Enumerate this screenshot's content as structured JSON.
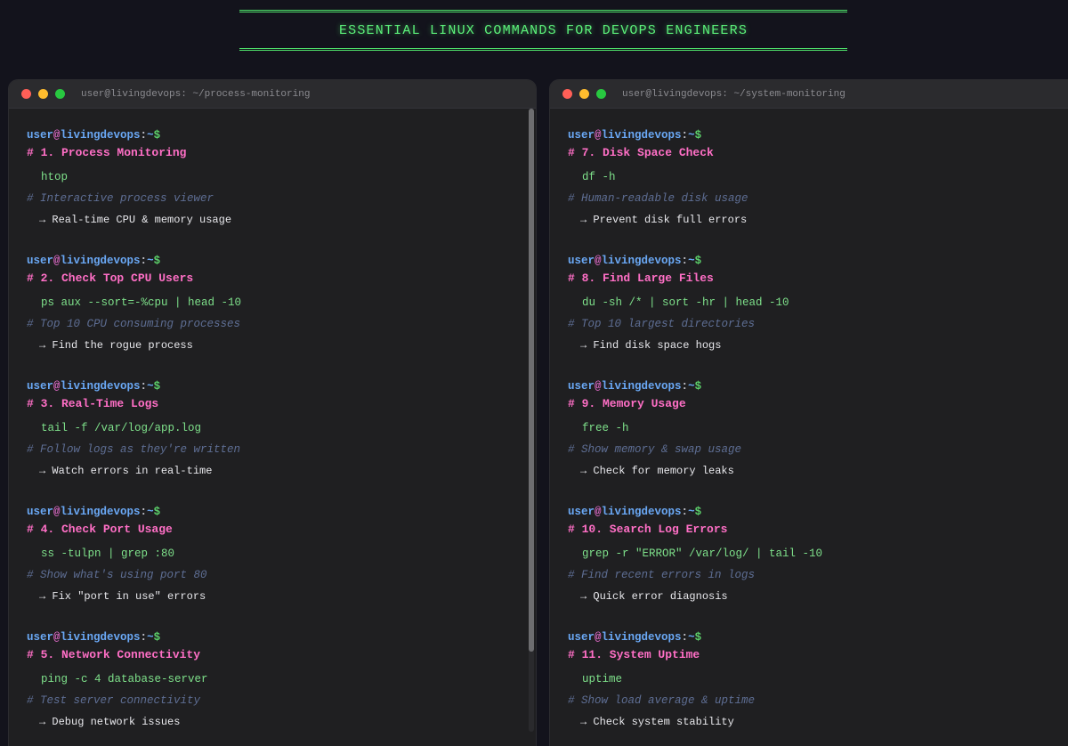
{
  "banner": {
    "title": "ESSENTIAL LINUX COMMANDS FOR DEVOPS ENGINEERS"
  },
  "colors": {
    "accent_green": "#5cf07a",
    "heading_pink": "#ff6fc6",
    "prompt_blue": "#6aa8f5",
    "command_green": "#7ee08a",
    "comment_slate": "#5e6e94"
  },
  "prompt": {
    "user": "user",
    "at": "@",
    "host": "livingdevops",
    "sep": ":",
    "path": "~",
    "dollar": "$"
  },
  "left": {
    "title": "user@livingdevops: ~/process-monitoring",
    "entries": [
      {
        "heading": "# 1. Process Monitoring",
        "command": "htop",
        "comment": "# Interactive process viewer",
        "note": "→ Real-time CPU & memory usage"
      },
      {
        "heading": "# 2. Check Top CPU Users",
        "command": "ps aux --sort=-%cpu | head -10",
        "comment": "# Top 10 CPU consuming processes",
        "note": "→ Find the rogue process"
      },
      {
        "heading": "# 3. Real-Time Logs",
        "command": "tail -f /var/log/app.log",
        "comment": "# Follow logs as they're written",
        "note": "→ Watch errors in real-time"
      },
      {
        "heading": "# 4. Check Port Usage",
        "command": "ss -tulpn | grep :80",
        "comment": "# Show what's using port 80",
        "note": "→ Fix \"port in use\" errors"
      },
      {
        "heading": "# 5. Network Connectivity",
        "command": "ping -c 4 database-server",
        "comment": "# Test server connectivity",
        "note": "→ Debug network issues"
      }
    ]
  },
  "right": {
    "title": "user@livingdevops: ~/system-monitoring",
    "entries": [
      {
        "heading": "# 7. Disk Space Check",
        "command": "df -h",
        "comment": "# Human-readable disk usage",
        "note": "→ Prevent disk full errors"
      },
      {
        "heading": "# 8. Find Large Files",
        "command": "du -sh /* | sort -hr | head -10",
        "comment": "# Top 10 largest directories",
        "note": "→ Find disk space hogs"
      },
      {
        "heading": "# 9. Memory Usage",
        "command": "free -h",
        "comment": "# Show memory & swap usage",
        "note": "→ Check for memory leaks"
      },
      {
        "heading": "# 10. Search Log Errors",
        "command": "grep -r \"ERROR\" /var/log/ | tail -10",
        "comment": "# Find recent errors in logs",
        "note": "→ Quick error diagnosis"
      },
      {
        "heading": "# 11. System Uptime",
        "command": "uptime",
        "comment": "# Show load average & uptime",
        "note": "→ Check system stability"
      }
    ]
  }
}
